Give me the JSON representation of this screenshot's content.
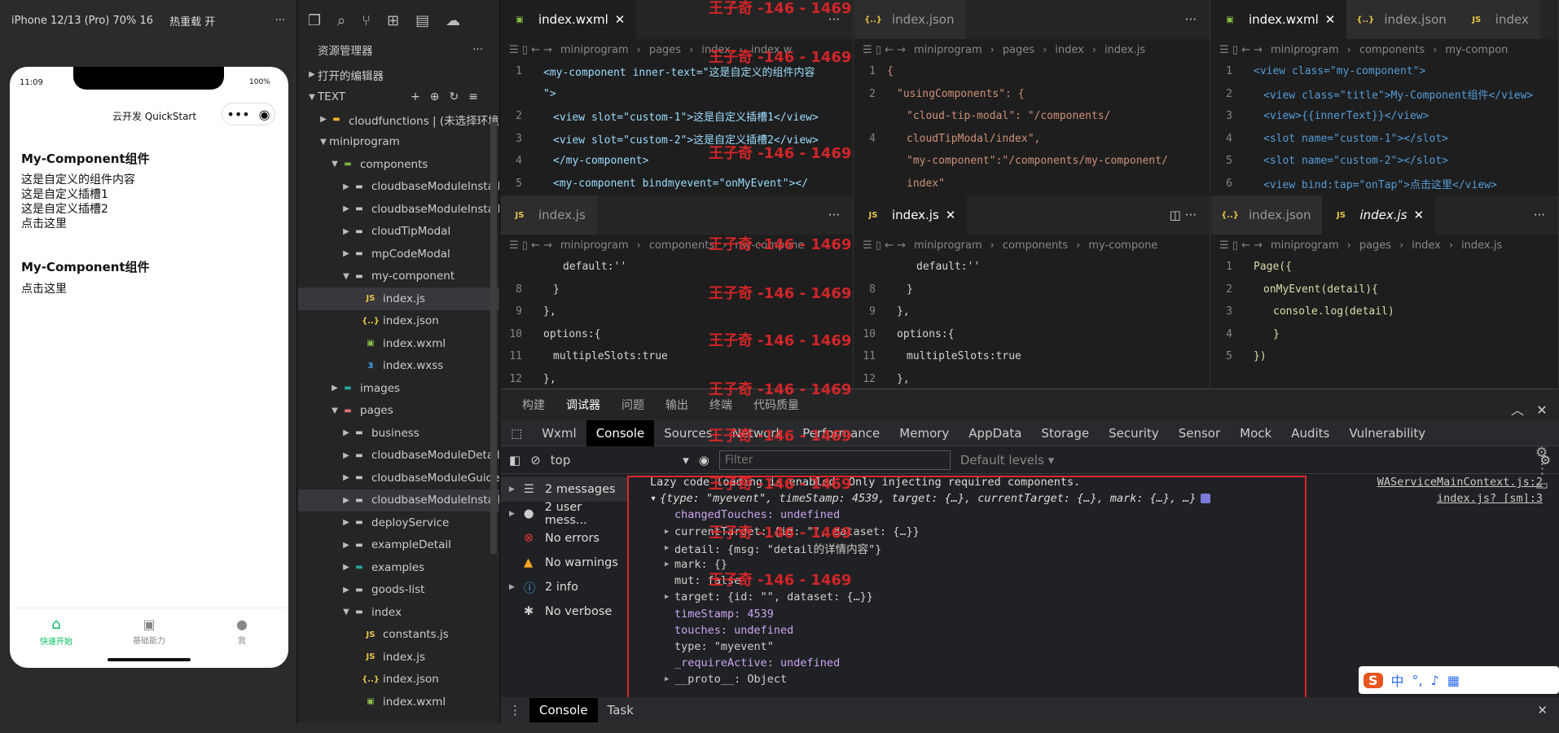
{
  "simulator": {
    "device": "iPhone 12/13 (Pro) 70% 16",
    "hot_reload": "热重载 开",
    "more": "···",
    "phone": {
      "time": "11:09",
      "battery": "100%",
      "nav_title": "云开发 QuickStart",
      "block1_title": "My-Component组件",
      "block1_lines": [
        "这是自定义的组件内容",
        "这是自定义插槽1",
        "这是自定义插槽2",
        "点击这里"
      ],
      "block2_title": "My-Component组件",
      "block2_line": "点击这里",
      "tabs": [
        "快速开始",
        "基础能力",
        "我"
      ]
    }
  },
  "explorer": {
    "title": "资源管理器",
    "more": "···",
    "open_editors": "打开的编辑器",
    "root": "TEXT",
    "rows": [
      {
        "label": "cloudfunctions | (未选择环境)",
        "caret": "▶",
        "indent": 1,
        "icon": "folder-orange"
      },
      {
        "label": "miniprogram",
        "caret": "▼",
        "indent": 1,
        "icon": "none"
      },
      {
        "label": "components",
        "caret": "▼",
        "indent": 2,
        "icon": "folder-green"
      },
      {
        "label": "cloudbaseModuleInstall...",
        "caret": "▶",
        "indent": 3,
        "icon": "folder"
      },
      {
        "label": "cloudbaseModuleInstall...",
        "caret": "▶",
        "indent": 3,
        "icon": "folder"
      },
      {
        "label": "cloudTipModal",
        "caret": "▶",
        "indent": 3,
        "icon": "folder"
      },
      {
        "label": "mpCodeModal",
        "caret": "▶",
        "indent": 3,
        "icon": "folder"
      },
      {
        "label": "my-component",
        "caret": "▼",
        "indent": 3,
        "icon": "folder"
      },
      {
        "label": "index.js",
        "caret": "",
        "indent": 4,
        "icon": "js",
        "sel": true
      },
      {
        "label": "index.json",
        "caret": "",
        "indent": 4,
        "icon": "json"
      },
      {
        "label": "index.wxml",
        "caret": "",
        "indent": 4,
        "icon": "wxml"
      },
      {
        "label": "index.wxss",
        "caret": "",
        "indent": 4,
        "icon": "wxss"
      },
      {
        "label": "images",
        "caret": "▶",
        "indent": 2,
        "icon": "folder-img"
      },
      {
        "label": "pages",
        "caret": "▼",
        "indent": 2,
        "icon": "folder-red"
      },
      {
        "label": "business",
        "caret": "▶",
        "indent": 3,
        "icon": "folder"
      },
      {
        "label": "cloudbaseModuleDetail",
        "caret": "▶",
        "indent": 3,
        "icon": "folder"
      },
      {
        "label": "cloudbaseModuleGuide",
        "caret": "▶",
        "indent": 3,
        "icon": "folder"
      },
      {
        "label": "cloudbaseModuleInstall...",
        "caret": "▶",
        "indent": 3,
        "icon": "folder",
        "sel": true
      },
      {
        "label": "deployService",
        "caret": "▶",
        "indent": 3,
        "icon": "folder"
      },
      {
        "label": "exampleDetail",
        "caret": "▶",
        "indent": 3,
        "icon": "folder"
      },
      {
        "label": "examples",
        "caret": "▶",
        "indent": 3,
        "icon": "folder-img"
      },
      {
        "label": "goods-list",
        "caret": "▶",
        "indent": 3,
        "icon": "folder"
      },
      {
        "label": "index",
        "caret": "▼",
        "indent": 3,
        "icon": "folder"
      },
      {
        "label": "constants.js",
        "caret": "",
        "indent": 4,
        "icon": "js"
      },
      {
        "label": "index.js",
        "caret": "",
        "indent": 4,
        "icon": "js"
      },
      {
        "label": "index.json",
        "caret": "",
        "indent": 4,
        "icon": "json"
      },
      {
        "label": "index.wxml",
        "caret": "",
        "indent": 4,
        "icon": "wxml"
      }
    ]
  },
  "editors": {
    "p1": {
      "tab": "index.wxml",
      "tab2": "index.js",
      "crumbs": [
        "miniprogram",
        "pages",
        "index",
        "index.w"
      ],
      "crumbs2": [
        "miniprogram",
        "components",
        "my-compone"
      ]
    },
    "p2": {
      "tab": "index.json",
      "tab2": "index.js",
      "crumbs": [
        "miniprogram",
        "pages",
        "index",
        "index.js"
      ],
      "crumbs2": [
        "miniprogram",
        "components",
        "my-compone"
      ]
    },
    "p3": {
      "tabs": [
        "index.wxml",
        "index.json",
        "index"
      ],
      "tabs2": [
        "index.json",
        "index.js"
      ],
      "crumbs": [
        "miniprogram",
        "components",
        "my-compon"
      ],
      "crumbs2": [
        "miniprogram",
        "pages",
        "index",
        "index.js"
      ]
    }
  },
  "code": {
    "wxml_a": [
      "<my-component inner-text=\"这是自定义的组件内容",
      "\">",
      "<view slot=\"custom-1\">这是自定义插槽1</view>",
      "<view slot=\"custom-2\">这是自定义插槽2</view>",
      "</my-component>",
      "<my-component bindmyevent=\"onMyEvent\"></"
    ],
    "json_a": [
      "{",
      "\"usingComponents\": {",
      "\"cloud-tip-modal\": \"/components/",
      "cloudTipModal/index\",",
      "\"my-component\":\"/components/my-component/",
      "index\""
    ],
    "wxml_b": [
      "<view class=\"my-component\">",
      "<view class=\"title\">My-Component组件</view>",
      "<view>{{innerText}}</view>",
      "<slot name=\"custom-1\"></slot>",
      "<slot name=\"custom-2\"></slot>",
      "<view bind:tap=\"onTap\">点击这里</view>"
    ],
    "js_a": [
      "default:''",
      "}",
      "},",
      "options:{",
      "multipleSlots:true",
      "},"
    ],
    "js_b": [
      "Page({",
      "onMyEvent(detail){",
      "console.log(detail)",
      "}",
      "})"
    ],
    "ln_a": [
      "1",
      "",
      "2",
      "3",
      "4",
      "5"
    ],
    "ln_b": [
      "1",
      "2",
      "",
      "4",
      ""
    ],
    "ln_c": [
      "1",
      "2",
      "3",
      "4",
      "5",
      "6"
    ],
    "ln_d": [
      "",
      "8",
      "9",
      "10",
      "11",
      "12"
    ],
    "ln_e": [
      "1",
      "2",
      "3",
      "4",
      "5"
    ]
  },
  "devtools": {
    "top_tabs": [
      "构建",
      "调试器",
      "问题",
      "输出",
      "终端",
      "代码质量"
    ],
    "tabs": [
      "Wxml",
      "Console",
      "Sources",
      "Network",
      "Performance",
      "Memory",
      "AppData",
      "Storage",
      "Security",
      "Sensor",
      "Mock",
      "Audits",
      "Vulnerability"
    ],
    "context": "top",
    "filter_placeholder": "Filter",
    "levels": "Default levels",
    "sidebar": [
      "2 messages",
      "2 user mess...",
      "No errors",
      "No warnings",
      "2 info",
      "No verbose"
    ],
    "log": {
      "lazy": "Lazy code loading is enabled. Only injecting required components.",
      "lazy_src": "WAServiceMainContext.js:2",
      "obj_src": "index.js? [sm]:3",
      "summary": "{type: \"myevent\", timeStamp: 4539, target: {…}, currentTarget: {…}, mark: {…}, …}",
      "props": [
        "changedTouches: undefined",
        "currentTarget: {id: \"\", dataset: {…}}",
        "detail: {msg: \"detail的详情内容\"}",
        "mark: {}",
        "mut: false",
        "target: {id: \"\", dataset: {…}}",
        "timeStamp: 4539",
        "touches: undefined",
        "type: \"myevent\"",
        "_requireActive: undefined",
        "__proto__: Object"
      ]
    },
    "bottom_tabs": [
      "Console",
      "Task"
    ]
  },
  "watermark": "王子奇 -146 - 1469"
}
